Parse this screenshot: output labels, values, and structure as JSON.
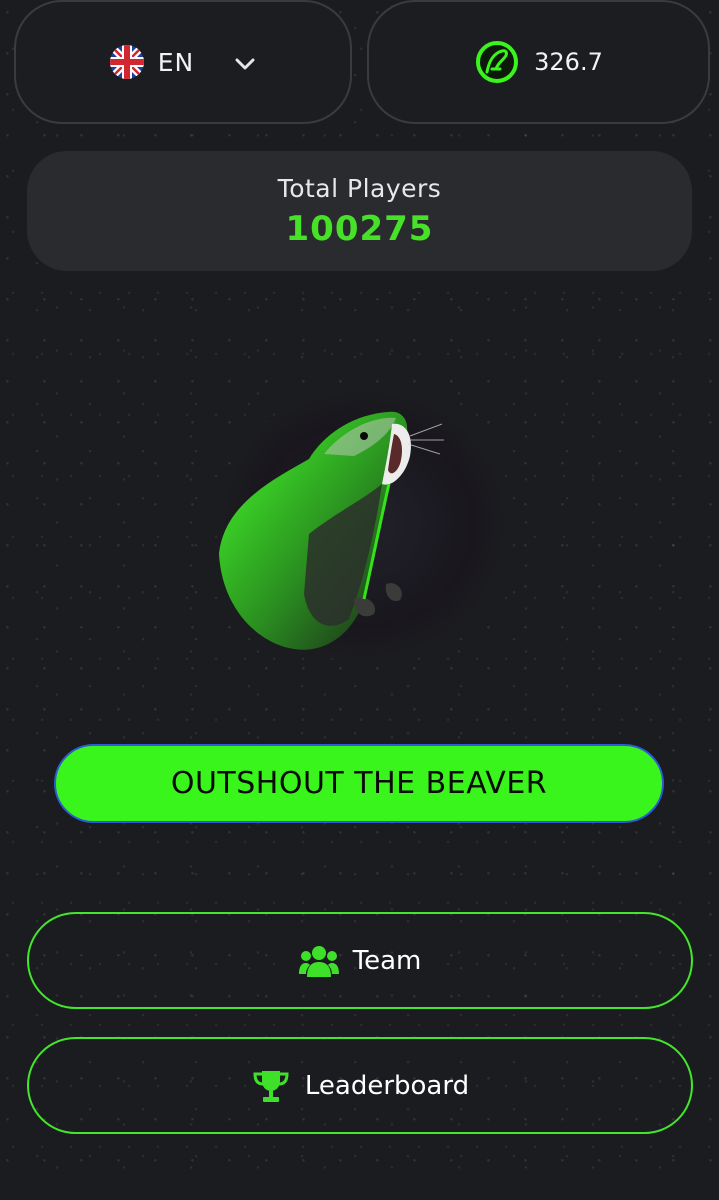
{
  "language": {
    "code": "EN",
    "flag_icon": "uk-flag-icon",
    "dropdown_icon": "chevron-down-icon"
  },
  "balance": {
    "value": "326.7",
    "icon": "coin-icon",
    "icon_color": "#39f51b"
  },
  "stats": {
    "total_players_label": "Total Players",
    "total_players_value": "100275"
  },
  "hero": {
    "image": "shouting-beaver-avatar"
  },
  "actions": {
    "shout_label": "OUTSHOUT THE BEAVER",
    "team_label": "Team",
    "team_icon": "users-icon",
    "leaderboard_label": "Leaderboard",
    "leaderboard_icon": "trophy-icon"
  },
  "colors": {
    "accent": "#39f51b",
    "accent_text": "#47e227",
    "background": "#1b1c20",
    "panel": "#2a2b2f"
  }
}
